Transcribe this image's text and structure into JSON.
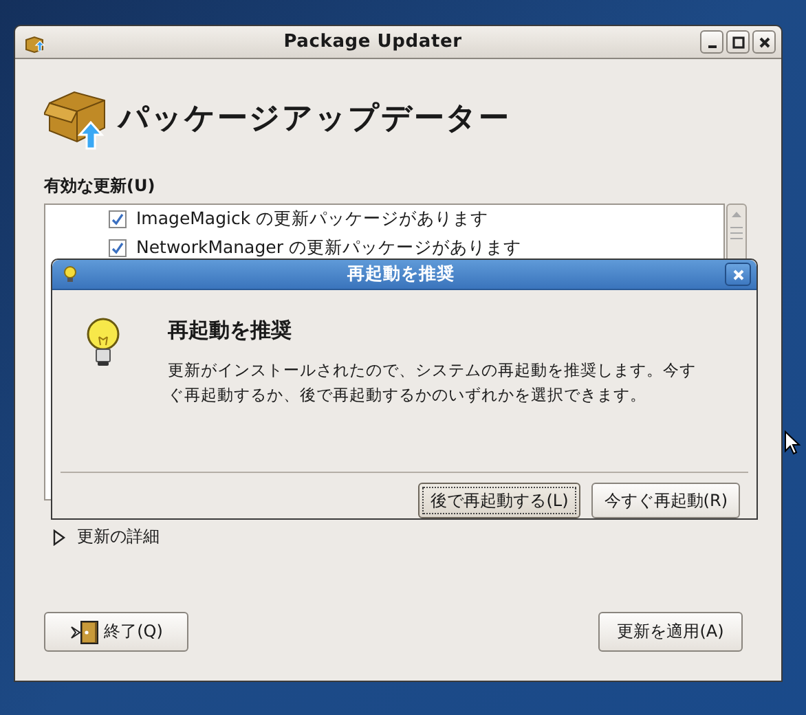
{
  "window": {
    "title": "Package Updater"
  },
  "header": {
    "title": "パッケージアップデーター"
  },
  "updates": {
    "label": "有効な更新(U)",
    "items": [
      {
        "text": "ImageMagick の更新パッケージがあります",
        "checked": true
      },
      {
        "text": "NetworkManager の更新パッケージがあります",
        "checked": true
      }
    ]
  },
  "details": {
    "label": "更新の詳細",
    "expanded": false
  },
  "buttons": {
    "quit": "終了(Q)",
    "apply": "更新を適用(A)"
  },
  "dialog": {
    "title": "再起動を推奨",
    "heading": "再起動を推奨",
    "message": "更新がインストールされたので、システムの再起動を推奨します。今すぐ再起動するか、後で再起動するかのいずれかを選択できます。",
    "buttons": [
      {
        "label": "後で再起動する(L)",
        "selected": true
      },
      {
        "label": "今すぐ再起動(R)",
        "selected": false
      }
    ]
  }
}
